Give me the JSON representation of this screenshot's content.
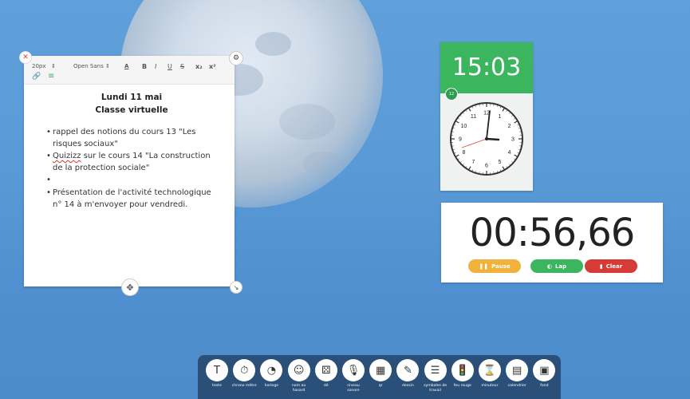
{
  "note": {
    "toolbar": {
      "font_size": "20px",
      "font_family": "Open Sans",
      "bold": "B",
      "italic": "I",
      "underline": "U",
      "strike": "S",
      "subscript": "x₂",
      "superscript": "x²"
    },
    "title_line1": "Lundi 11 mai",
    "title_line2": "Classe virtuelle",
    "item1": "rappel des notions du cours 13 \"Les risques sociaux\"",
    "item2_word": "Quizizz",
    "item2_rest": " sur le cours 14 \"La construction de la protection sociale\"",
    "item3": "Présentation de l'activité technologique n° 14 à m'envoyer pour vendredi."
  },
  "clock": {
    "digital_time": "15:03",
    "badge": "12",
    "numbers": [
      "12",
      "1",
      "2",
      "3",
      "4",
      "5",
      "6",
      "7",
      "8",
      "9",
      "10",
      "11"
    ]
  },
  "stopwatch": {
    "time": "00:56,66",
    "pause_label": "Pause",
    "lap_label": "Lap",
    "clear_label": "Clear",
    "colors": {
      "pause": "#f0b23a",
      "lap": "#3cb55f",
      "clear": "#d63b36"
    }
  },
  "dock": {
    "tools": [
      {
        "label": "texte",
        "icon": "text-icon"
      },
      {
        "label": "chrono mètre",
        "icon": "stopwatch-icon"
      },
      {
        "label": "horloge",
        "icon": "clock-icon"
      },
      {
        "label": "nom au hasard",
        "icon": "random-name-icon"
      },
      {
        "label": "dé",
        "icon": "dice-icon"
      },
      {
        "label": "niveau sonore",
        "icon": "microphone-icon"
      },
      {
        "label": "qr",
        "icon": "qr-icon"
      },
      {
        "label": "dessin",
        "icon": "pencil-icon"
      },
      {
        "label": "symboles de travail",
        "icon": "work-symbols-icon"
      },
      {
        "label": "feu rouge",
        "icon": "traffic-light-icon"
      },
      {
        "label": "minuteur",
        "icon": "hourglass-icon"
      },
      {
        "label": "calendrier",
        "icon": "calendar-icon"
      },
      {
        "label": "fond",
        "icon": "image-icon"
      }
    ]
  }
}
